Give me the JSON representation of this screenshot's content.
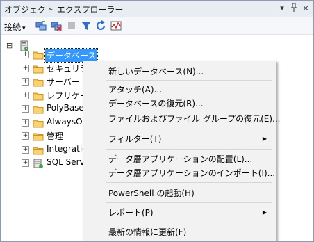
{
  "window": {
    "title": "オブジェクト エクスプローラー",
    "pin_glyph": "▾",
    "autohide_glyph": "ᛘ",
    "close_glyph": "×"
  },
  "toolbar": {
    "connect_label": "接続",
    "connect_caret": "▾"
  },
  "tree": {
    "root_expander": "⊟",
    "items": [
      {
        "label": "データベース",
        "expander": "+",
        "icon": "folder-icon"
      },
      {
        "label": "セキュリティ",
        "expander": "+",
        "icon": "folder-icon"
      },
      {
        "label": "サーバー オ",
        "expander": "+",
        "icon": "folder-icon"
      },
      {
        "label": "レプリケーシ",
        "expander": "+",
        "icon": "folder-icon"
      },
      {
        "label": "PolyBase",
        "expander": "+",
        "icon": "folder-icon"
      },
      {
        "label": "AlwaysOn",
        "expander": "+",
        "icon": "folder-icon"
      },
      {
        "label": "管理",
        "expander": "+",
        "icon": "folder-icon"
      },
      {
        "label": "Integration",
        "expander": "+",
        "icon": "folder-icon"
      },
      {
        "label": "SQL Serv",
        "expander": "+",
        "icon": "sql-agent-icon"
      }
    ]
  },
  "context_menu": {
    "items": [
      {
        "label": "新しいデータベース(N)..."
      },
      {
        "label": "アタッチ(A)..."
      },
      {
        "label": "データベースの復元(R)...",
        "highlighted": true
      },
      {
        "label": "ファイルおよびファイル グループの復元(E)..."
      },
      {
        "label": "フィルター(T)",
        "submenu_arrow": "▶"
      },
      {
        "label": "データ層アプリケーションの配置(L)..."
      },
      {
        "label": "データ層アプリケーションのインポート(I)..."
      },
      {
        "label": "PowerShell の起動(H)"
      },
      {
        "label": "レポート(P)",
        "submenu_arrow": "▶"
      },
      {
        "label": "最新の情報に更新(F)"
      }
    ]
  },
  "colors": {
    "selection": "#3399ff",
    "highlight_border": "#e8380d",
    "highlight_fill": "#fff4c9",
    "menu_bg": "#f2f2f2"
  }
}
